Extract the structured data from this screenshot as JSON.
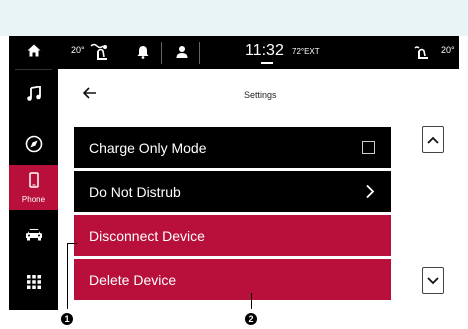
{
  "status": {
    "left_temp": "20°",
    "time": "11:32",
    "ext_temp": "72°EXT",
    "right_temp": "20°"
  },
  "sidebar": {
    "items": [
      {
        "icon": "home-icon",
        "label": ""
      },
      {
        "icon": "music-icon",
        "label": ""
      },
      {
        "icon": "navigation-icon",
        "label": ""
      },
      {
        "icon": "phone-icon",
        "label": "Phone",
        "active": true
      },
      {
        "icon": "car-icon",
        "label": ""
      },
      {
        "icon": "apps-grid-icon",
        "label": ""
      }
    ]
  },
  "header": {
    "title": "Settings"
  },
  "settings": {
    "rows": [
      {
        "label": "Charge Only Mode",
        "control": "checkbox"
      },
      {
        "label": "Do Not Distrub",
        "control": "chevron"
      },
      {
        "label": "Disconnect Device",
        "control": "none"
      },
      {
        "label": "Delete Device",
        "control": "none"
      }
    ]
  },
  "callouts": {
    "one": "1",
    "two": "2"
  },
  "colors": {
    "accent": "#b8103a",
    "background": "#000000"
  }
}
